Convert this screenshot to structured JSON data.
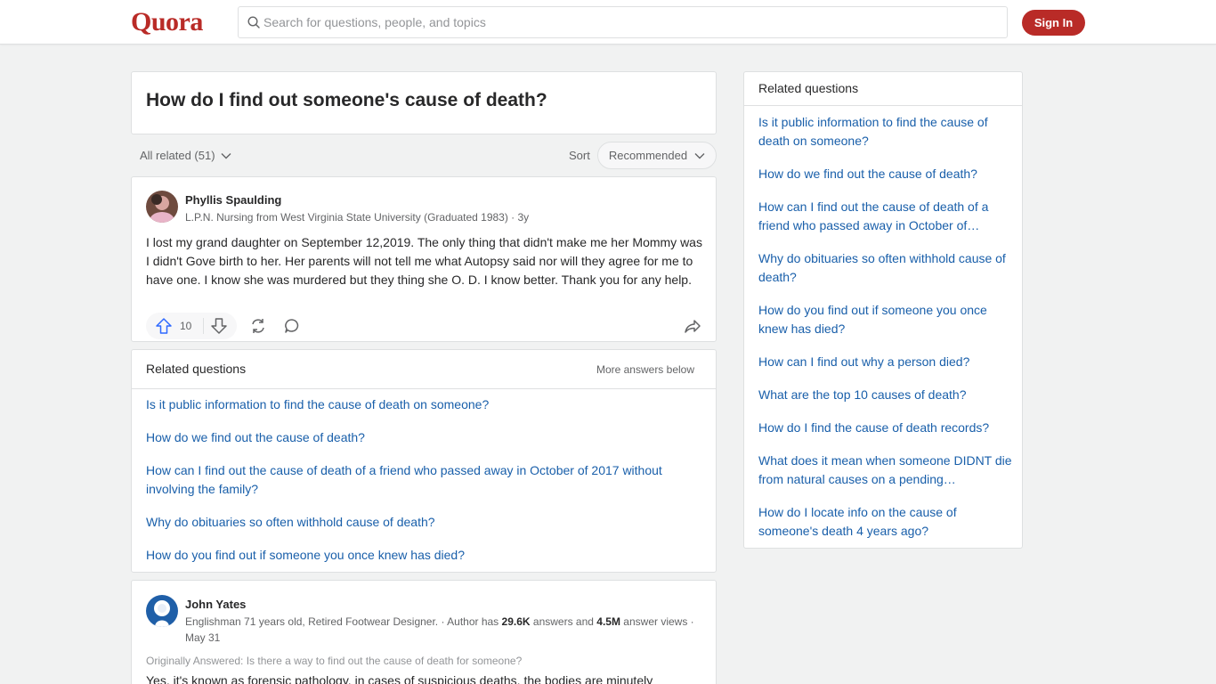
{
  "header": {
    "logo": "Quora",
    "search_placeholder": "Search for questions, people, and topics",
    "signin_label": "Sign In"
  },
  "question": {
    "title": "How do I find out someone's cause of death?"
  },
  "filter": {
    "all_related": "All related (51)",
    "sort_label": "Sort",
    "sort_value": "Recommended"
  },
  "answers": [
    {
      "author": "Phyllis Spaulding",
      "credential": "L.P.N. Nursing from West Virginia State University (Graduated 1983) · 3y",
      "text": "I lost my grand daughter on September 12,2019. The only thing that didn't make me her Mommy was I didn't Gove birth to her. Her parents will not tell me what Autopsy said nor will they agree for me to have one. I know she was murdered but they thing she O. D. I know better. Thank you for any help.",
      "upvotes": "10"
    },
    {
      "author": "John Yates",
      "credential_pre": "Englishman 71 years old, Retired Footwear Designer. · Author has ",
      "answers_count": "29.6K",
      "credential_mid": " answers and ",
      "views_count": "4.5M",
      "credential_post": " answer views · May 31",
      "originally_answered": "Originally Answered: Is there a way to find out the cause of death for someone?",
      "text": "Yes, it's known as forensic pathology, in cases of suspicious deaths, the bodies are minutely"
    }
  ],
  "related_inline": {
    "heading": "Related questions",
    "more": "More answers below",
    "items": [
      "Is it public information to find the cause of death on someone?",
      "How do we find out the cause of death?",
      "How can I find out the cause of death of a friend who passed away in October of 2017 without involving the family?",
      "Why do obituaries so often withhold cause of death?",
      "How do you find out if someone you once knew has died?"
    ]
  },
  "sidebar": {
    "heading": "Related questions",
    "items": [
      "Is it public information to find the cause of death on someone?",
      "How do we find out the cause of death?",
      "How can I find out the cause of death of a friend who passed away in October of…",
      "Why do obituaries so often withhold cause of death?",
      "How do you find out if someone you once knew has died?",
      "How can I find out why a person died?",
      "What are the top 10 causes of death?",
      "How do I find the cause of death records?",
      "What does it mean when someone DIDNT die from natural causes on a pending…",
      "How do I locate info on the cause of someone's death 4 years ago?"
    ]
  },
  "colors": {
    "brand": "#b92b27",
    "link": "#195faa",
    "upvote": "#2e69ff"
  }
}
